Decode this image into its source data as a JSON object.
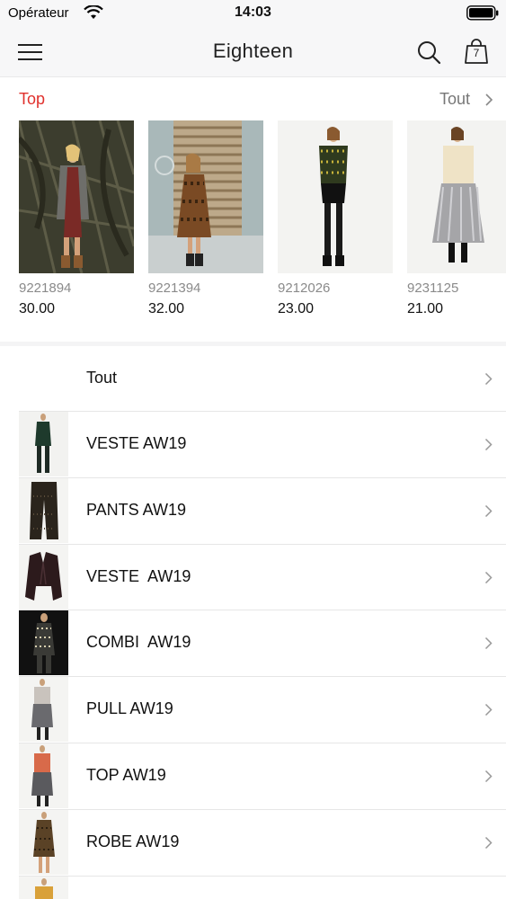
{
  "status_bar": {
    "carrier": "Opérateur",
    "time": "14:03"
  },
  "nav": {
    "title": "Eighteen",
    "cart_count": "7"
  },
  "top": {
    "title": "Top",
    "see_all": "Tout",
    "products": [
      {
        "code": "9221894",
        "price": "30.00"
      },
      {
        "code": "9221394",
        "price": "32.00"
      },
      {
        "code": "9212026",
        "price": "23.00"
      },
      {
        "code": "9231125",
        "price": "21.00"
      }
    ]
  },
  "categories": [
    {
      "label": "Tout"
    },
    {
      "label": "VESTE AW19"
    },
    {
      "label": "PANTS AW19"
    },
    {
      "label": "VESTE  AW19"
    },
    {
      "label": "COMBI  AW19"
    },
    {
      "label": "PULL AW19"
    },
    {
      "label": "TOP AW19"
    },
    {
      "label": "ROBE AW19"
    }
  ],
  "colors": {
    "accent": "#e0302c",
    "muted": "#8a8a8a"
  }
}
